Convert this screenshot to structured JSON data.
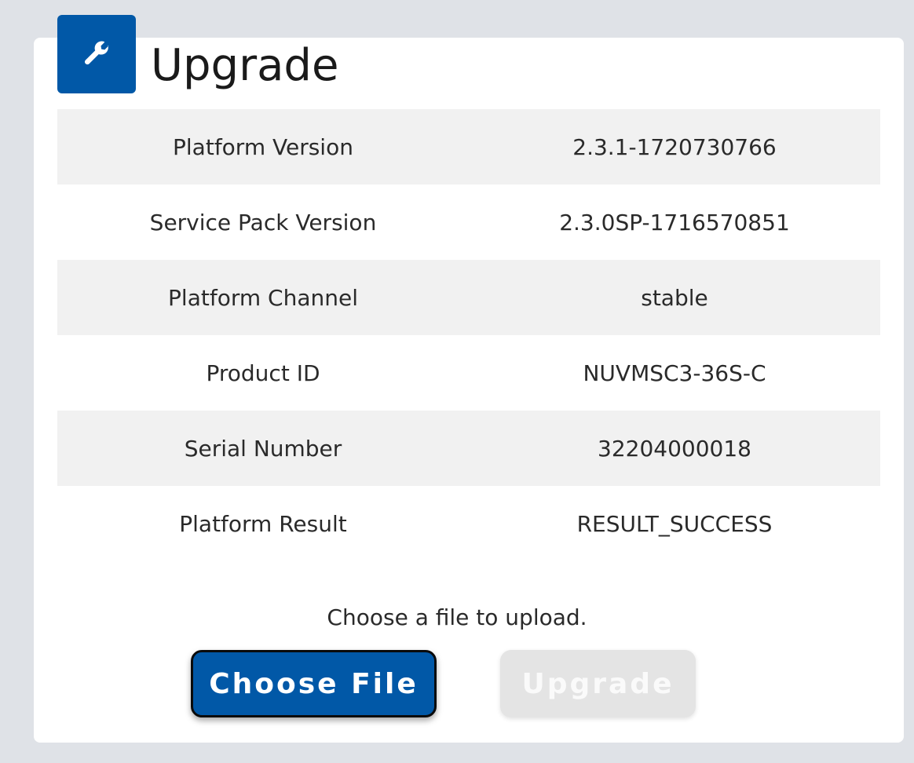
{
  "header": {
    "title": "Upgrade",
    "icon": "wrench-icon",
    "icon_color": "#0158a7"
  },
  "info_rows": [
    {
      "label": "Platform Version",
      "value": "2.3.1-1720730766"
    },
    {
      "label": "Service Pack Version",
      "value": "2.3.0SP-1716570851"
    },
    {
      "label": "Platform Channel",
      "value": "stable"
    },
    {
      "label": "Product ID",
      "value": "NUVMSC3-36S-C"
    },
    {
      "label": "Serial Number",
      "value": "32204000018"
    },
    {
      "label": "Platform Result",
      "value": "RESULT_SUCCESS"
    }
  ],
  "upload": {
    "hint": "Choose a file to upload.",
    "choose_label": "Choose File",
    "upgrade_label": "Upgrade",
    "upgrade_disabled": true
  },
  "colors": {
    "accent": "#0158a7",
    "background": "#dfe2e7",
    "row_shade": "#f1f1f1"
  }
}
